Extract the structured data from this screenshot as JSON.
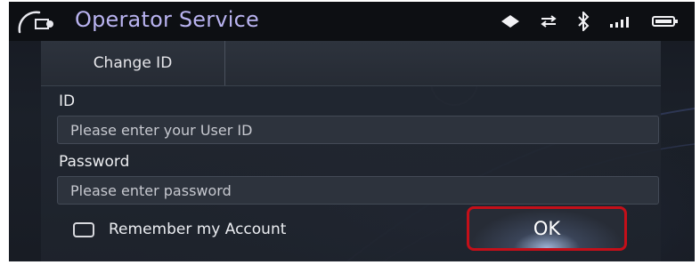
{
  "header": {
    "title": "Operator Service",
    "status_icons": [
      "location-arrow-icon",
      "data-transfer-icon",
      "bluetooth-icon",
      "signal-strength-icon",
      "battery-icon"
    ]
  },
  "tabs": [
    {
      "label": "Change ID"
    }
  ],
  "form": {
    "id_label": "ID",
    "id_placeholder": "Please enter your User ID",
    "password_label": "Password",
    "password_placeholder": "Please enter password",
    "remember_label": "Remember my Account",
    "remember_checked": false,
    "ok_label": "OK"
  },
  "colors": {
    "title": "#b9b3f0",
    "highlight": "#c40f19",
    "background": "#1b2029"
  }
}
